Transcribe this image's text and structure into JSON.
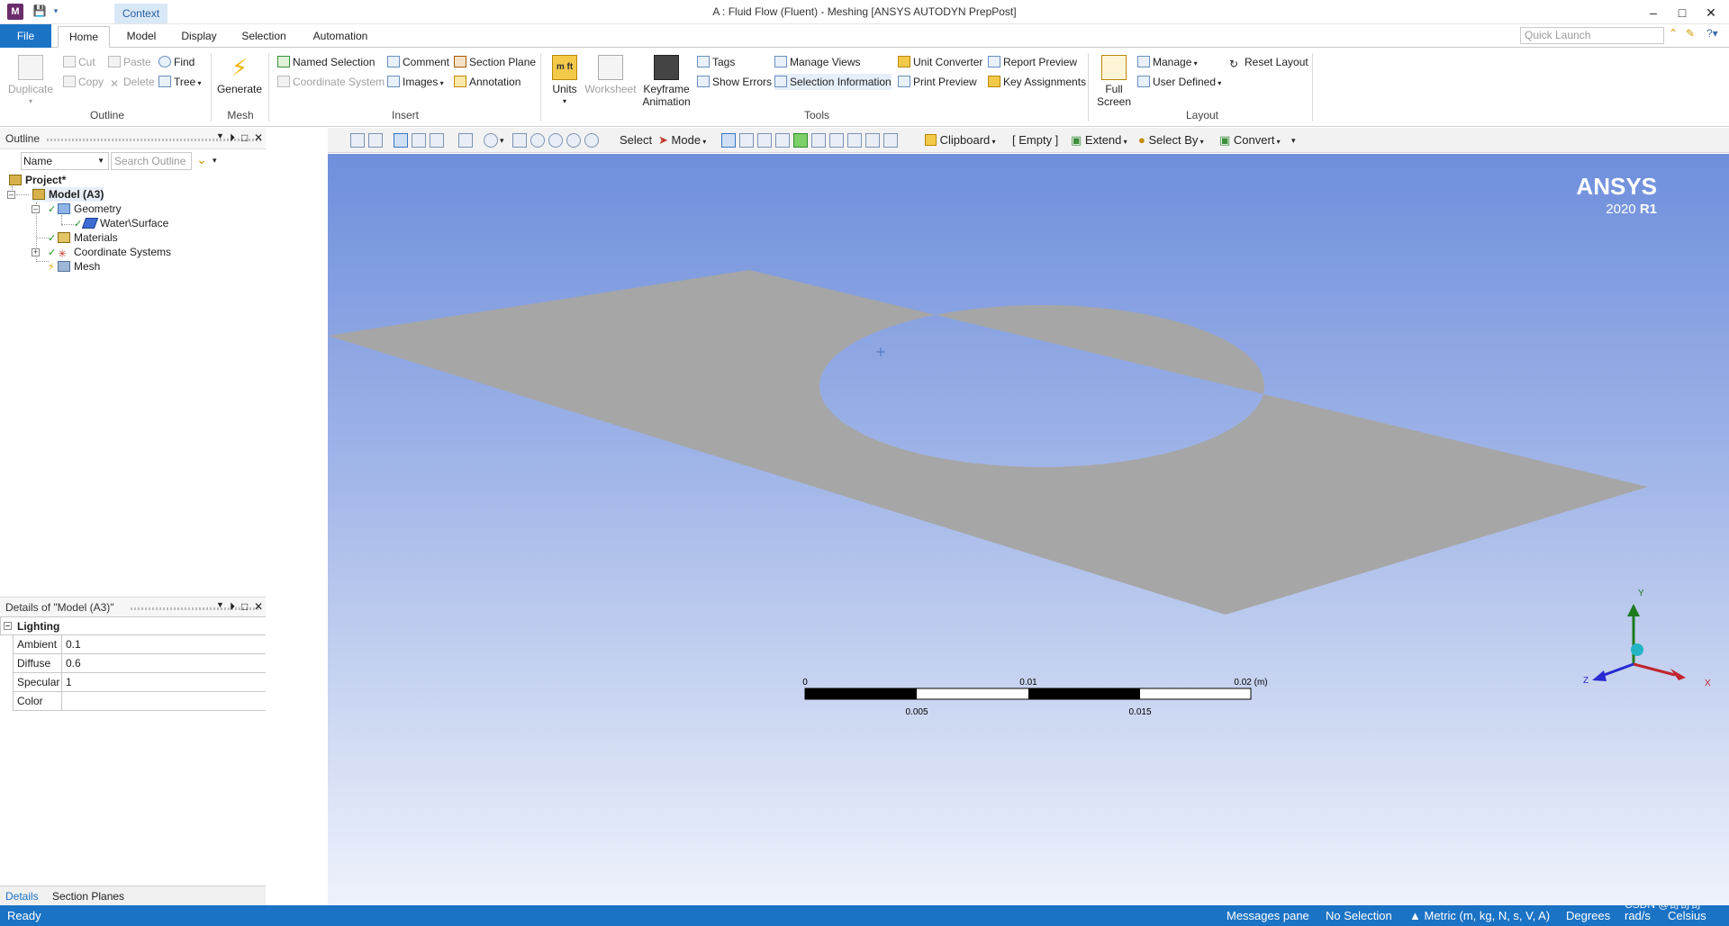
{
  "titlebar": {
    "app_icon": "M",
    "context_tab": "Context",
    "title": "A : Fluid Flow (Fluent) - Meshing [ANSYS AUTODYN PrepPost]",
    "window_buttons": [
      "–",
      "□",
      "✕"
    ]
  },
  "tabs": {
    "file": "File",
    "items": [
      "Home",
      "Model",
      "Display",
      "Selection",
      "Automation"
    ],
    "active": "Home",
    "quick_launch_placeholder": "Quick Launch"
  },
  "ribbon": {
    "outline": {
      "label": "Outline",
      "duplicate": "Duplicate",
      "cut": "Cut",
      "copy": "Copy",
      "paste": "Paste",
      "delete": "Delete",
      "find": "Find",
      "tree": "Tree"
    },
    "mesh": {
      "label": "Mesh",
      "generate": "Generate"
    },
    "insert": {
      "label": "Insert",
      "named_selection": "Named Selection",
      "coordinate_system": "Coordinate System",
      "comment": "Comment",
      "images": "Images",
      "section_plane": "Section Plane",
      "annotation": "Annotation"
    },
    "tools": {
      "label": "Tools",
      "units_line1": "m ft",
      "units": "Units",
      "worksheet": "Worksheet",
      "keyframe_1": "Keyframe",
      "keyframe_2": "Animation",
      "tags": "Tags",
      "show_errors": "Show Errors",
      "manage_views": "Manage Views",
      "selection_information": "Selection Information",
      "unit_converter": "Unit Converter",
      "print_preview": "Print Preview",
      "report_preview": "Report Preview",
      "key_assignments": "Key Assignments"
    },
    "layout": {
      "label": "Layout",
      "full_1": "Full",
      "full_2": "Screen",
      "manage": "Manage",
      "user_defined": "User Defined",
      "reset_layout": "Reset Layout"
    }
  },
  "graphics_toolbar": {
    "select": "Select",
    "mode": "Mode",
    "clipboard": "Clipboard",
    "empty": "[ Empty ]",
    "extend": "Extend",
    "select_by": "Select By",
    "convert": "Convert"
  },
  "outline_pane": {
    "title": "Outline",
    "filter_value": "Name",
    "search_placeholder": "Search Outline",
    "tree": {
      "project": "Project*",
      "model": "Model (A3)",
      "geometry": "Geometry",
      "body": "Water\\Surface",
      "materials": "Materials",
      "coordinate_systems": "Coordinate Systems",
      "mesh": "Mesh"
    }
  },
  "details_pane": {
    "title": "Details of \"Model (A3)\"",
    "section": "Lighting",
    "rows": [
      {
        "key": "Ambient",
        "value": "0.1"
      },
      {
        "key": "Diffuse",
        "value": "0.6"
      },
      {
        "key": "Specular",
        "value": "1"
      },
      {
        "key": "Color",
        "value": ""
      }
    ]
  },
  "bottom_tabs": [
    "Details",
    "Section Planes"
  ],
  "viewport": {
    "brand": "ANSYS",
    "version": "2020",
    "release": "R1",
    "scale": {
      "labels_top": [
        "0",
        "0.01",
        "0.02 (m)"
      ],
      "labels_bottom": [
        "0.005",
        "0.015"
      ]
    },
    "triad": {
      "x": "X",
      "y": "Y",
      "z": "Z"
    },
    "colors": {
      "surface": "#a6a6a6",
      "hole": "#a9b9e9",
      "bg_top": "#6f8fdc",
      "bg_bottom": "#eef2fb"
    }
  },
  "status": {
    "ready": "Ready",
    "messages": "Messages pane",
    "selection": "No Selection",
    "units": "Metric (m, kg, N, s, V, A)",
    "degrees": "Degrees",
    "rad": "rad/s",
    "temp": "Celsius",
    "watermark": "CSDN @奇奇奇"
  }
}
